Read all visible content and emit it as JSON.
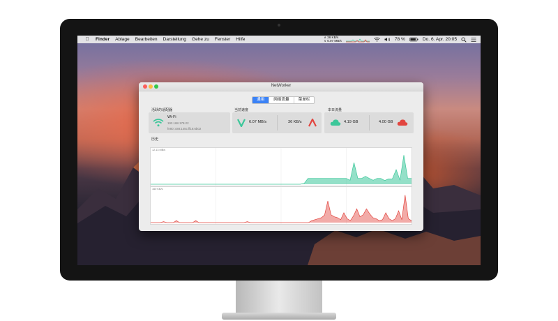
{
  "menubar": {
    "apple_icon": "",
    "app_name": "Finder",
    "items": [
      "Ablage",
      "Bearbeiten",
      "Darstellung",
      "Gehe zu",
      "Fenster",
      "Hilfe"
    ],
    "upload_speed": "∧ 36 KB/s",
    "download_speed": "∨ 6.07 MB/s",
    "battery_pct": "78 %",
    "datetime": "Do. 6. Apr.  20:05",
    "status_icons": [
      "wifi-icon",
      "volume-icon",
      "battery-icon",
      "search-icon",
      "list-icon"
    ]
  },
  "window": {
    "title": "NetWorker",
    "tabs": [
      {
        "label": "通用",
        "active": true
      },
      {
        "label": "网络流量",
        "active": false
      },
      {
        "label": "菜单栏",
        "active": false
      }
    ],
    "adapter": {
      "section_label": "活跃的适配器",
      "name": "Wi-Fi",
      "ipv4": "192.168.178.22",
      "ipv6": "fe80::c88:145c:ff16:6b02"
    },
    "speed": {
      "section_label": "当前速度",
      "download": "6.07 MB/s",
      "upload": "36 KB/s"
    },
    "traffic": {
      "section_label": "本日流量",
      "downloaded": "4.19 GB",
      "uploaded": "4.00 GB"
    },
    "history": {
      "section_label": "历史",
      "download_axis_max": "12.13 MB/s",
      "upload_axis_max": "160 KB/s"
    },
    "colors": {
      "download": "#3cc79a",
      "upload": "#e2453f",
      "tab_active": "#3b82f6"
    }
  },
  "chart_data": [
    {
      "type": "area",
      "title": "",
      "series": [
        {
          "values": [
            0,
            0,
            0,
            0,
            0,
            0,
            0,
            0,
            0,
            0,
            0,
            0,
            0,
            0,
            0,
            0,
            0,
            0,
            0,
            0,
            0,
            0,
            0,
            0,
            0,
            0,
            0,
            0,
            0,
            0,
            0,
            0,
            0,
            0,
            0,
            0,
            0,
            0,
            0,
            0,
            0.3,
            2.2,
            2.2,
            2.2,
            2.2,
            2.2,
            2.2,
            2.2,
            2.2,
            2.2,
            2.2,
            2.2,
            1.5,
            8.2,
            2.2,
            2.2,
            3.0,
            2.2,
            1.5,
            2.2,
            2.2,
            1.4,
            2.0,
            2.0,
            5.5,
            1.5,
            11.0,
            2.2,
            2.2
          ]
        }
      ],
      "ylim": [
        0,
        12.13
      ],
      "ylabel": "12.13 MB/s"
    },
    {
      "type": "area",
      "title": "",
      "series": [
        {
          "values": [
            0,
            0,
            0,
            0,
            5,
            0,
            0,
            0,
            10,
            0,
            0,
            0,
            0,
            0,
            10,
            0,
            0,
            0,
            0,
            0,
            0,
            0,
            0,
            0,
            0,
            0,
            0,
            0,
            0,
            0,
            5,
            0,
            0,
            0,
            0,
            0,
            0,
            0,
            0,
            0,
            0,
            0,
            0,
            0,
            0,
            0,
            0,
            0,
            0,
            0,
            10,
            15,
            20,
            25,
            38,
            110,
            40,
            30,
            25,
            15,
            50,
            20,
            10,
            35,
            70,
            30,
            40,
            70,
            45,
            25,
            20,
            10,
            15,
            50,
            20,
            10,
            20,
            60,
            15,
            140,
            20,
            10
          ]
        }
      ],
      "ylim": [
        0,
        160
      ],
      "ylabel": "160 KB/s"
    }
  ]
}
